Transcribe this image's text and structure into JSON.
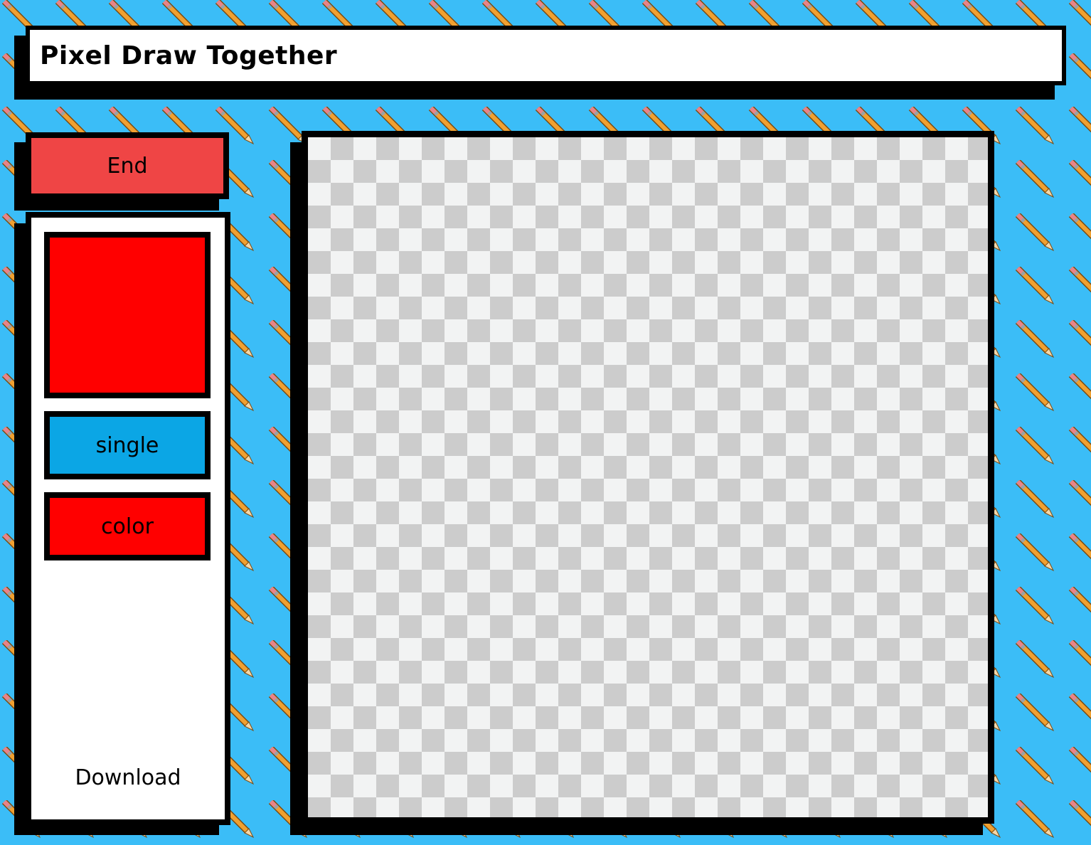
{
  "app": {
    "title": "Pixel Draw Together"
  },
  "toolbar": {
    "end_label": "End",
    "selected_color": "#ff0000",
    "mode_label": "single",
    "color_label": "color",
    "download_label": "Download"
  },
  "theme": {
    "background": "#3bbdf7",
    "end_button_color": "#ef4545",
    "single_button_color": "#0ba6e5",
    "color_button_color": "#ff0000",
    "background_pattern_icon": "pencil-icon"
  }
}
